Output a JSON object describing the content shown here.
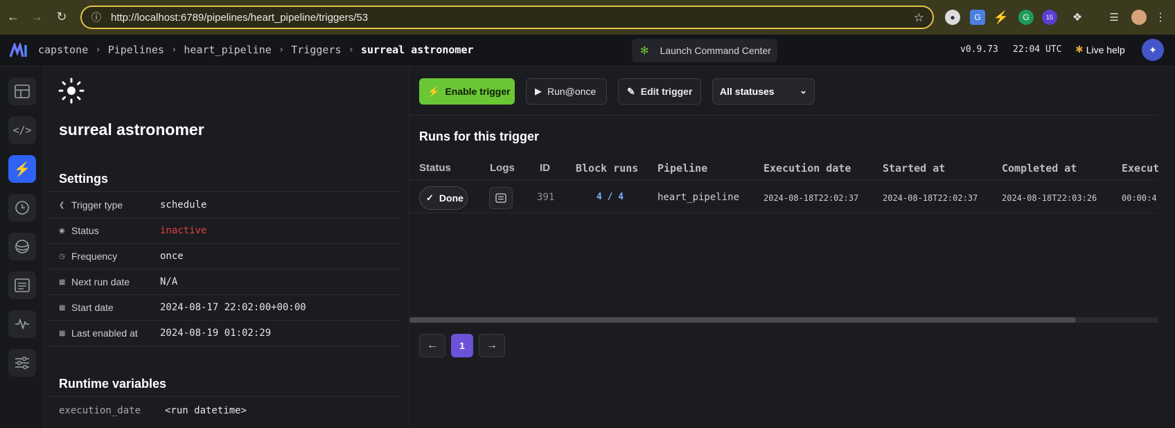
{
  "browser": {
    "url": "http://localhost:6789/pipelines/heart_pipeline/triggers/53",
    "ext_badge": "15"
  },
  "header": {
    "breadcrumbs": [
      "capstone",
      "Pipelines",
      "heart_pipeline",
      "Triggers",
      "surreal astronomer"
    ],
    "command_center": "Launch Command Center",
    "version": "v0.9.73",
    "time": "22:04 UTC",
    "live_help": "Live help"
  },
  "trigger": {
    "name": "surreal astronomer",
    "settings_title": "Settings",
    "settings": [
      {
        "label": "Trigger type",
        "value": "schedule"
      },
      {
        "label": "Status",
        "value": "inactive"
      },
      {
        "label": "Frequency",
        "value": "once"
      },
      {
        "label": "Next run date",
        "value": "N/A"
      },
      {
        "label": "Start date",
        "value": "2024-08-17 22:02:00+00:00"
      },
      {
        "label": "Last enabled at",
        "value": "2024-08-19 01:02:29"
      }
    ],
    "runtime_title": "Runtime variables",
    "runtime": {
      "name": "execution_date",
      "value": "<run datetime>"
    }
  },
  "toolbar": {
    "enable": "Enable trigger",
    "run_once": "Run@once",
    "edit": "Edit trigger",
    "status_filter": "All statuses"
  },
  "runs": {
    "title": "Runs for this trigger",
    "columns": [
      "Status",
      "Logs",
      "ID",
      "Block runs",
      "Pipeline",
      "Execution date",
      "Started at",
      "Completed at",
      "Execut"
    ],
    "rows": [
      {
        "status": "Done",
        "id": "391",
        "block_runs": "4 / 4",
        "pipeline": "heart_pipeline",
        "execution_date": "2024-08-18T22:02:37",
        "started_at": "2024-08-18T22:02:37",
        "completed_at": "2024-08-18T22:03:26",
        "execution_time": "00:00:4"
      }
    ],
    "page": "1"
  },
  "colors": {
    "accent_green": "#6ac634",
    "accent_blue": "#2e63f5",
    "page_purple": "#6b52d6",
    "inactive_red": "#e0423c"
  }
}
